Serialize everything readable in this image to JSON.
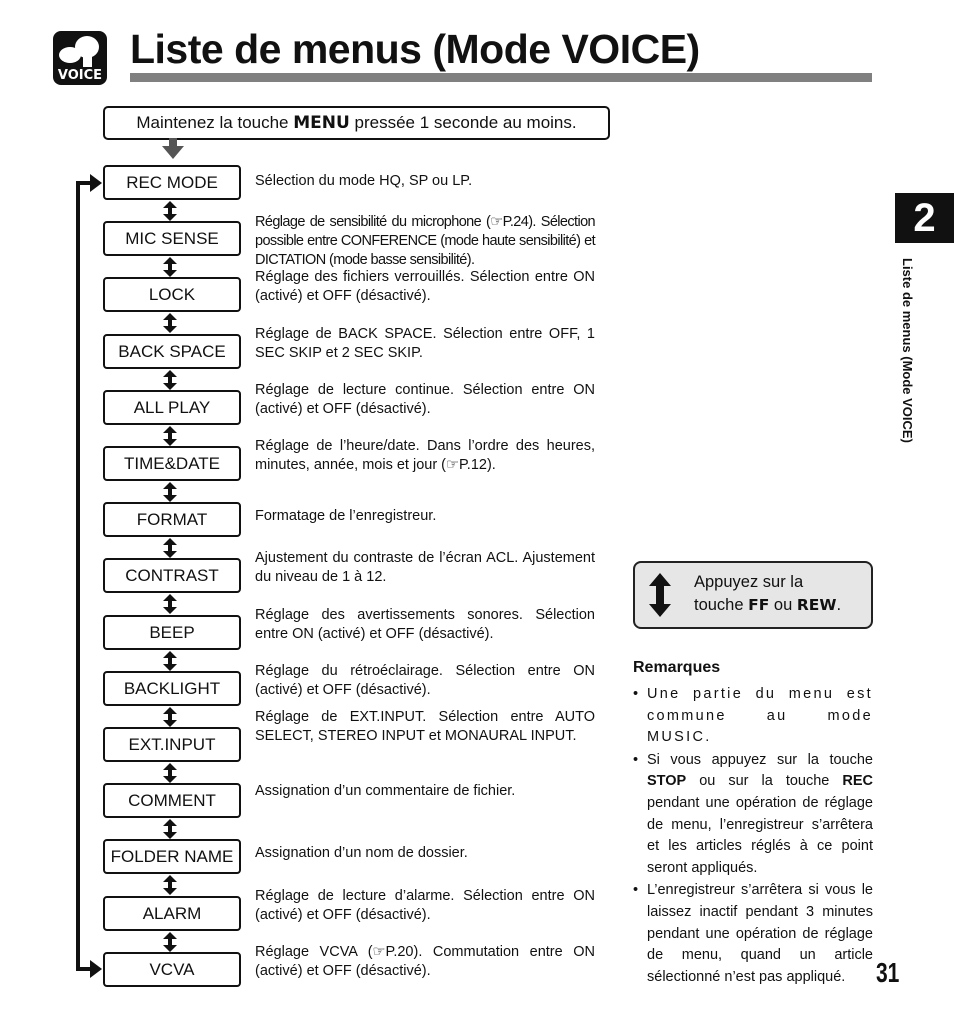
{
  "header": {
    "icon_label": "VOICE",
    "title": "Liste de menus (Mode VOICE)"
  },
  "instruction": {
    "prefix": "Maintenez la touche ",
    "key": "MENU",
    "suffix": " pressée 1 seconde au moins."
  },
  "menu_items": [
    {
      "label": "REC MODE",
      "description": "Sélection du mode HQ, SP ou LP."
    },
    {
      "label": "MIC SENSE",
      "description": "Réglage de sensibilité du microphone (☞P.24). Sélection possible entre CONFERENCE (mode haute sensibilité) et DICTATION (mode basse sensibilité)."
    },
    {
      "label": "LOCK",
      "description": "Réglage des fichiers verrouillés. Sélection entre ON (activé) et OFF (désactivé)."
    },
    {
      "label": "BACK SPACE",
      "description": "Réglage de BACK SPACE. Sélection entre OFF, 1 SEC SKIP et 2 SEC SKIP."
    },
    {
      "label": "ALL PLAY",
      "description": "Réglage de lecture continue. Sélection entre ON (activé) et OFF (désactivé)."
    },
    {
      "label": "TIME&DATE",
      "description": "Réglage de l’heure/date. Dans l’ordre des heures, minutes, année, mois et jour (☞P.12)."
    },
    {
      "label": "FORMAT",
      "description": "Formatage de l’enregistreur."
    },
    {
      "label": "CONTRAST",
      "description": "Ajustement du contraste de l’écran ACL. Ajustement du niveau de 1 à 12."
    },
    {
      "label": "BEEP",
      "description": "Réglage des avertissements sonores. Sélection entre ON (activé) et OFF (désactivé)."
    },
    {
      "label": "BACKLIGHT",
      "description": "Réglage du rétroéclairage. Sélection entre ON (activé) et OFF (désactivé)."
    },
    {
      "label": "EXT.INPUT",
      "description": "Réglage de EXT.INPUT. Sélection entre AUTO SELECT, STEREO INPUT et MONAURAL INPUT."
    },
    {
      "label": "COMMENT",
      "description": "Assignation d’un commentaire de fichier."
    },
    {
      "label": "FOLDER NAME",
      "description": "Assignation d’un nom de dossier."
    },
    {
      "label": "ALARM",
      "description": "Réglage de lecture d’alarme. Sélection entre ON (activé) et OFF (désactivé)."
    },
    {
      "label": "VCVA",
      "description": "Réglage VCVA (☞P.20). Commutation entre ON (activé) et OFF (désactivé)."
    }
  ],
  "side_tab": {
    "chapter": "2",
    "title": "Liste de menus (Mode VOICE)"
  },
  "ffrew_note": {
    "line1": "Appuyez sur la",
    "line2_prefix": "touche ",
    "key1": "FF",
    "mid": " ou ",
    "key2": "REW",
    "end": "."
  },
  "remarks": {
    "title": "Remarques",
    "item1": "Une partie du menu est commune au mode MUSIC.",
    "item2_a": "Si vous appuyez sur la touche ",
    "item2_key1": "STOP",
    "item2_b": " ou sur la touche ",
    "item2_key2": "REC",
    "item2_c": " pendant une opération de réglage de menu, l’enregistreur s’arrêtera et les articles réglés à ce point seront appliqués.",
    "item3": "L’enregistreur s’arrêtera si vous le laissez inactif pendant 3 minutes pendant une opération de réglage de menu, quand un article sélectionné n’est pas appliqué."
  },
  "page_number": "31"
}
